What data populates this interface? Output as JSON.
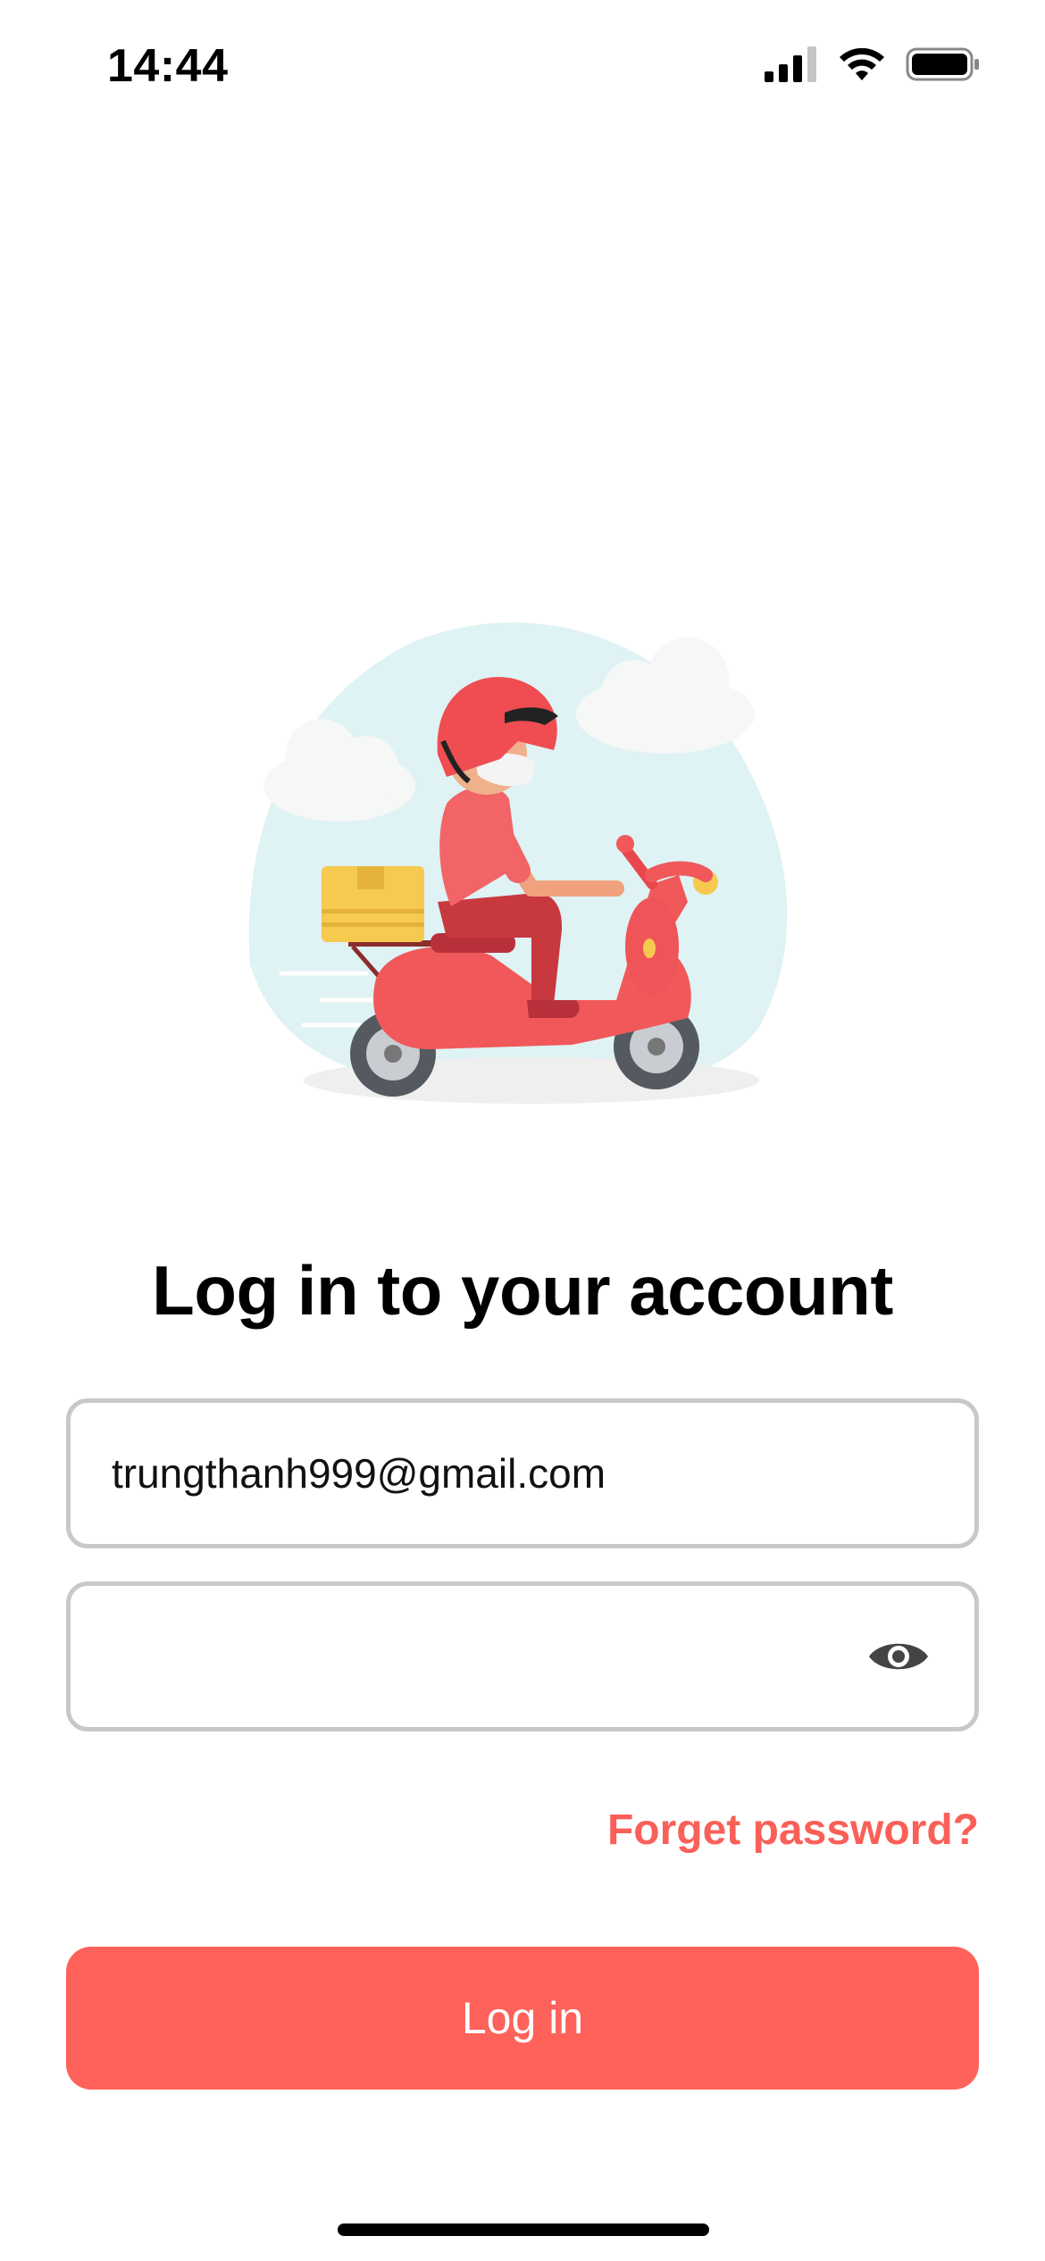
{
  "status_bar": {
    "time": "14:44"
  },
  "login": {
    "title": "Log in to your account",
    "email_value": "trungthanh999@gmail.com",
    "password_value": "",
    "forgot_password_label": "Forget password?",
    "login_button_label": "Log in"
  },
  "colors": {
    "accent": "#fe625a",
    "link": "#fa6058",
    "field_border": "#c8c8c8"
  },
  "icons": {
    "password_toggle": "eye-icon",
    "signal": "cellular-signal-icon",
    "wifi": "wifi-icon",
    "battery": "battery-icon"
  }
}
